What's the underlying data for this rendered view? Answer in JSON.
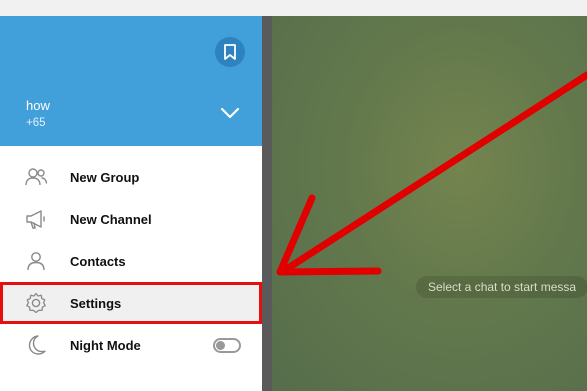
{
  "profile": {
    "name": "how",
    "phone": "+65"
  },
  "icons": {
    "bookmark": "bookmark-icon",
    "expand": "chevron-down-icon"
  },
  "menu": {
    "items": [
      {
        "label": "New Group",
        "icon": "group-icon"
      },
      {
        "label": "New Channel",
        "icon": "megaphone-icon"
      },
      {
        "label": "Contacts",
        "icon": "person-icon"
      },
      {
        "label": "Settings",
        "icon": "gear-icon"
      },
      {
        "label": "Night Mode",
        "icon": "moon-icon"
      }
    ]
  },
  "night_mode": {
    "on": false
  },
  "chat": {
    "placeholder": "Select a chat to start messa"
  },
  "colors": {
    "header": "#419fd9",
    "highlight": "#e50f0f",
    "annotation_arrow": "#e00000"
  }
}
